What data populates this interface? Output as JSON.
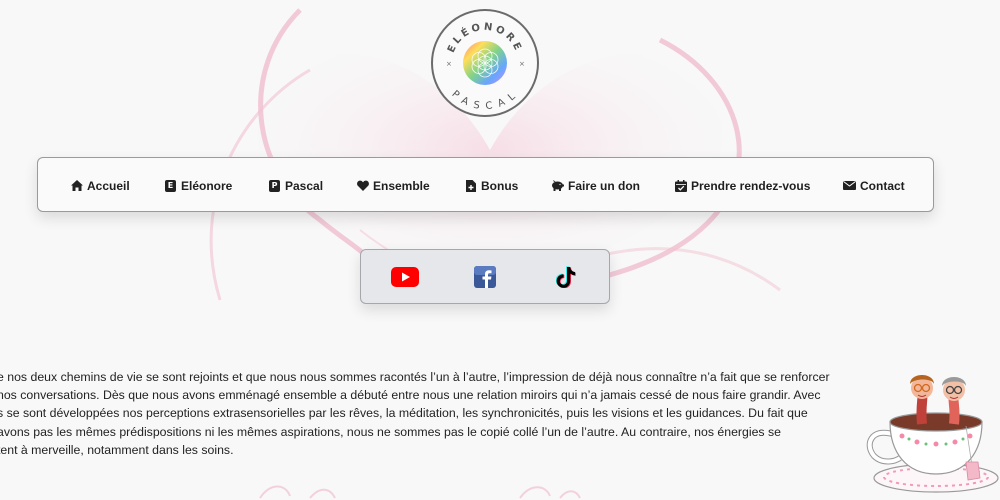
{
  "logo": {
    "top_text": "ELÉONORE",
    "bottom_text": "PASCAL"
  },
  "nav": {
    "items": [
      {
        "label": "Accueil",
        "icon": "home-icon"
      },
      {
        "label": "Eléonore",
        "icon": "letter-e-icon",
        "glyph": "E"
      },
      {
        "label": "Pascal",
        "icon": "letter-p-icon",
        "glyph": "P"
      },
      {
        "label": "Ensemble",
        "icon": "heart-icon"
      },
      {
        "label": "Bonus",
        "icon": "file-plus-icon"
      },
      {
        "label": "Faire un don",
        "icon": "piggy-bank-icon"
      },
      {
        "label": "Prendre rendez-vous",
        "icon": "calendar-check-icon"
      },
      {
        "label": "Contact",
        "icon": "envelope-icon"
      }
    ]
  },
  "social": [
    {
      "name": "YouTube",
      "icon": "youtube-icon",
      "color": "#ff0000"
    },
    {
      "name": "Facebook",
      "icon": "facebook-icon",
      "color": "#3b5998"
    },
    {
      "name": "TikTok",
      "icon": "tiktok-icon",
      "color": "#000000"
    }
  ],
  "body": {
    "lines": [
      "e nos deux chemins de vie se sont rejoints et que nous nous sommes racontés l’un à l’autre, l’impression de déjà nous connaître n’a fait que se renforcer",
      "nos conversations. Dès que nous avons emménagé ensemble a débuté entre nous une relation miroirs qui n’a jamais cessé de nous faire grandir. Avec",
      "s se sont développées nos perceptions extrasensorielles par les rêves, la méditation, les synchronicités, puis les visions et les guidances. Du fait que",
      "avons pas les mêmes prédispositions ni les mêmes aspirations, nous ne sommes pas le copié collé l’un de l’autre. Au contraire, nos énergies se",
      "tent à merveille, notamment dans les soins."
    ]
  },
  "colors": {
    "accent_pink": "#f5c3d2",
    "nav_background": "#fafafa",
    "social_background": "#e6e7ea"
  }
}
